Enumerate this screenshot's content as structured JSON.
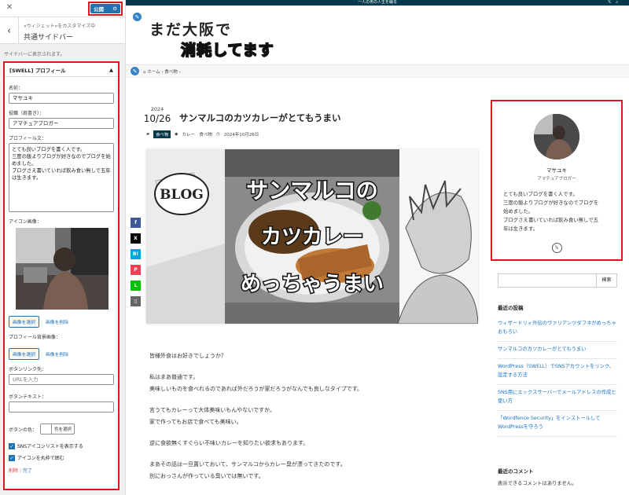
{
  "customizer": {
    "publish_label": "公開",
    "breadcrumb": "«ウィジェット»をカスタマイズ中",
    "title": "共通サイドバー",
    "description": "サイドバーに表示されます。",
    "widget": {
      "title": "[SWELL] プロフィール",
      "name_label": "名前：",
      "name_value": "マサユキ",
      "role_label": "役職（肩書き）：",
      "role_value": "アマチュアブロガー",
      "profile_label": "プロフィール文：",
      "profile_value": "とても良いブログを書く人です。\n三度の飯よりブログが好きなのでブログを始めました。\nブログさえ書いていれば飲み食い無しで五年は生きます。",
      "icon_label": "アイコン画像：",
      "select_image": "画像を選択",
      "delete_image": "画像を削除",
      "bg_label": "プロフィール背景画像：",
      "bg_select": "画像を選択",
      "bg_delete": "画像を削除",
      "link_label": "ボタンリンク先：",
      "link_placeholder": "URLを入力",
      "text_label": "ボタンテキスト：",
      "color_label": "ボタンの色：",
      "color_button": "色を選択",
      "sns_check": "SNSアイコンリストを表示する",
      "circle_check": "アイコンを丸枠で囲む",
      "delete": "削除",
      "done": "完了"
    }
  },
  "preview": {
    "topbar_text": "一人の男の人生を綴る",
    "logo_line1": "まだ大阪で",
    "logo_line2": "消耗してます",
    "breadcrumb_home": "ホーム",
    "breadcrumb_cat": "食べ物",
    "post": {
      "year": "2024",
      "month_day": "10/26",
      "title": "サンマルコのカツカレーがとてもうまい",
      "category": "食べ物",
      "tags": "カレー　食べ物",
      "date": "2024年10月26日",
      "image_text1": "サンマルコの",
      "image_text2": "カツカレー",
      "image_text3": "めっちゃうまい",
      "image_badge": "BLOG",
      "paragraphs": [
        "皆様外食はお好きでしょうか？",
        "私はまあ普通です。\n美味しいものを食べれるのであれば外だろうが家だろうがなんでも良しなタイプです。",
        "言うてもカレーって大体美味いもんやないですか。\n家で作ってもお店で食べても美味い。",
        "逆に食欲無くすぐらい不味いカレーを知りたい欲求もあります。",
        "まあその話は一旦置いておいて、サンマルコからカレー臭が漂ってきたのです。\n別におっさんが作っている臭いでは無いです。"
      ]
    },
    "share": [
      "f",
      "X",
      "B!",
      "P",
      "L",
      "▯"
    ],
    "profile": {
      "name": "マサユキ",
      "role": "アマチュアブロガー",
      "text": "とても良いブログを書く人です。\n三度の飯よりブログが好きなのでブログを\n始めました。\nブログさえ書いていれば飲み食い無しで五\n年は生きます。"
    },
    "search_button": "検索",
    "recent_heading": "最近の投稿",
    "recent": [
      "ウィザードリィ外伝のヴァリアンツダフネがめっちゃおもろい",
      "サンマルコのカツカレーがとてもうまい",
      "WordPress（SWELL）でSNSアカウントをリンク、設定する方法",
      "SNS用にエックスサーバーでメールアドレスの作成と使い方",
      "「Wordfence Security」をインストールしてWordPressを守ろう"
    ],
    "comments_heading": "最近のコメント",
    "no_comments": "表示できるコメントはありません。"
  }
}
